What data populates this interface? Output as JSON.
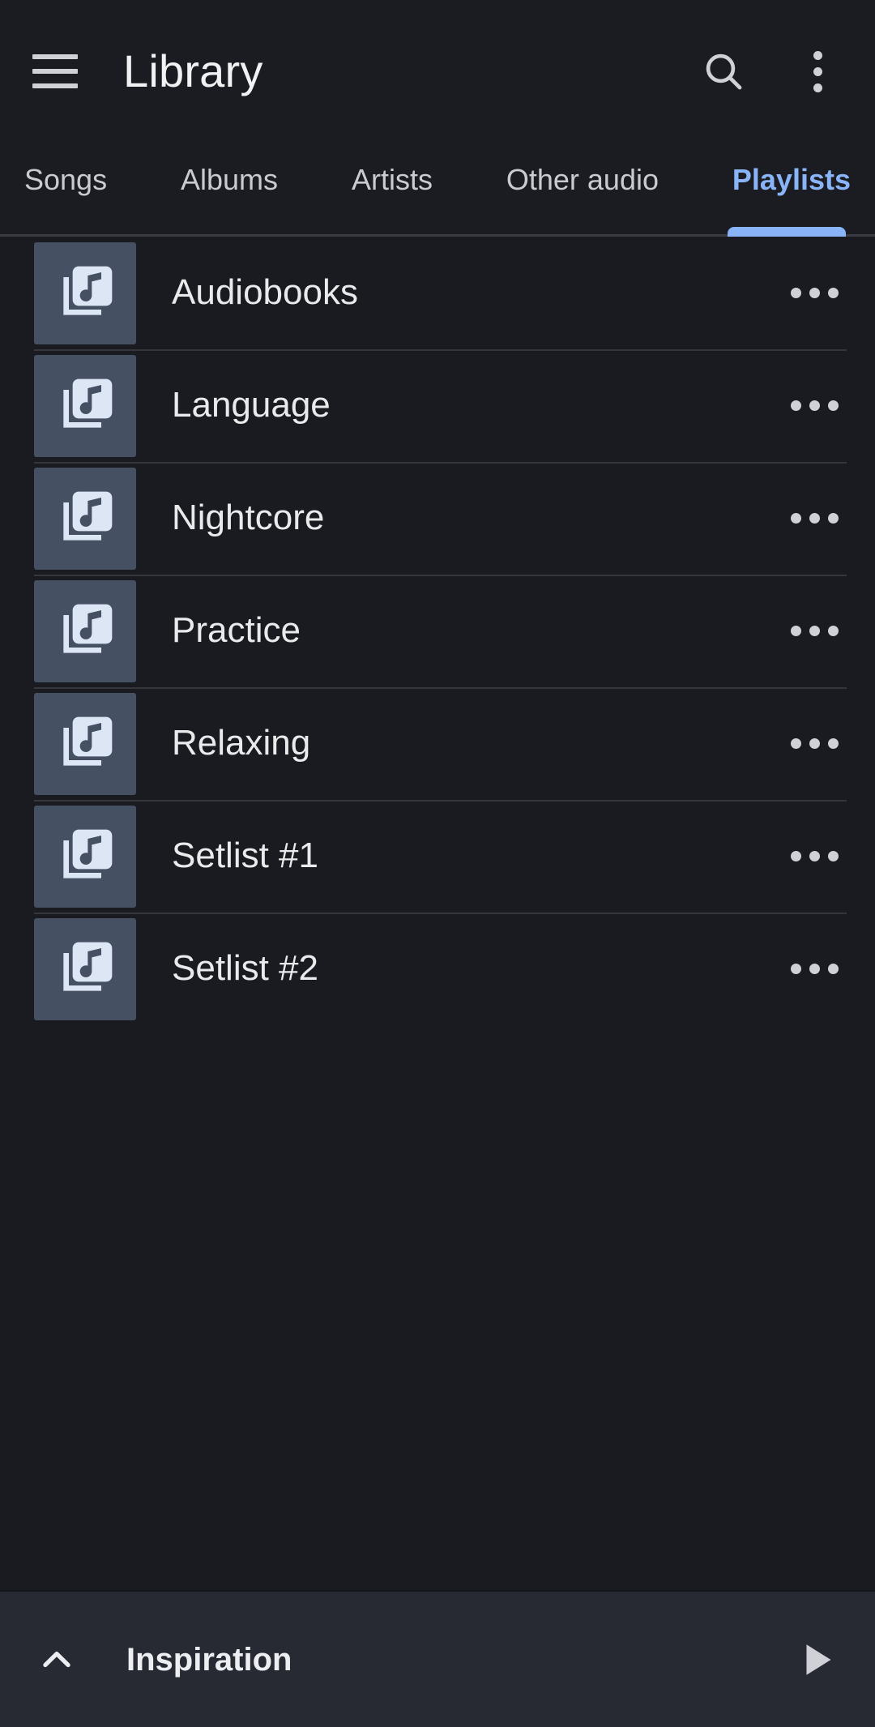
{
  "app": {
    "title": "Library",
    "theme": {
      "background": "#1a1b20",
      "appbar_background": "#1b1c21",
      "player_background": "#272a33",
      "accent": "#8ab4f8",
      "thumbnail_background": "#455063",
      "thumbnail_glyph": "#dde6f5",
      "primary_text": "#e9eaec",
      "secondary_text": "#c9cbd0",
      "divider": "#34363c"
    }
  },
  "appbar": {
    "menu_icon": "hamburger-menu-icon",
    "title": "Library",
    "actions": [
      {
        "name": "search-icon",
        "label": "Search"
      },
      {
        "name": "more-vert-icon",
        "label": "More options"
      }
    ]
  },
  "tabs": {
    "active_index": 4,
    "items": [
      {
        "label": "Songs"
      },
      {
        "label": "Albums"
      },
      {
        "label": "Artists"
      },
      {
        "label": "Other audio"
      },
      {
        "label": "Playlists"
      }
    ]
  },
  "playlists": {
    "items": [
      {
        "title": "Audiobooks",
        "icon": "library-music-icon",
        "more_icon": "more-horiz-icon"
      },
      {
        "title": "Language",
        "icon": "library-music-icon",
        "more_icon": "more-horiz-icon"
      },
      {
        "title": "Nightcore",
        "icon": "library-music-icon",
        "more_icon": "more-horiz-icon"
      },
      {
        "title": "Practice",
        "icon": "library-music-icon",
        "more_icon": "more-horiz-icon"
      },
      {
        "title": "Relaxing",
        "icon": "library-music-icon",
        "more_icon": "more-horiz-icon"
      },
      {
        "title": "Setlist #1",
        "icon": "library-music-icon",
        "more_icon": "more-horiz-icon"
      },
      {
        "title": "Setlist #2",
        "icon": "library-music-icon",
        "more_icon": "more-horiz-icon"
      }
    ]
  },
  "player": {
    "expand_icon": "chevron-up-icon",
    "title": "Inspiration",
    "play_icon": "play-icon"
  }
}
